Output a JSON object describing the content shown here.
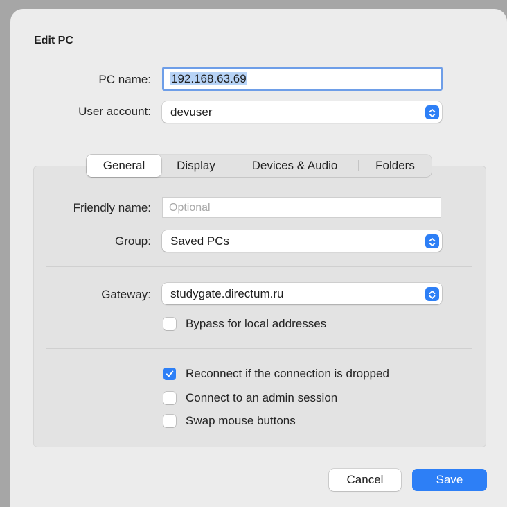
{
  "dialog": {
    "title": "Edit PC",
    "pc_name_label": "PC name:",
    "pc_name_value": "192.168.63.69",
    "user_account_label": "User account:",
    "user_account_value": "devuser"
  },
  "tabs": [
    {
      "label": "General",
      "active": true
    },
    {
      "label": "Display",
      "active": false
    },
    {
      "label": "Devices & Audio",
      "active": false
    },
    {
      "label": "Folders",
      "active": false
    }
  ],
  "general": {
    "friendly_name_label": "Friendly name:",
    "friendly_name_placeholder": "Optional",
    "friendly_name_value": "",
    "group_label": "Group:",
    "group_value": "Saved PCs",
    "gateway_label": "Gateway:",
    "gateway_value": "studygate.directum.ru",
    "bypass_label": "Bypass for local addresses",
    "bypass_checked": false,
    "reconnect_label": "Reconnect if the connection is dropped",
    "reconnect_checked": true,
    "admin_label": "Connect to an admin session",
    "admin_checked": false,
    "swap_label": "Swap mouse buttons",
    "swap_checked": false
  },
  "buttons": {
    "cancel": "Cancel",
    "save": "Save"
  },
  "colors": {
    "accent": "#2d7ff6",
    "selection": "#b7d3f6",
    "focus_ring": "#6e9ee8"
  },
  "icons": {
    "popup_arrows": "up-down-chevrons-icon",
    "checkmark": "checkmark-icon"
  }
}
